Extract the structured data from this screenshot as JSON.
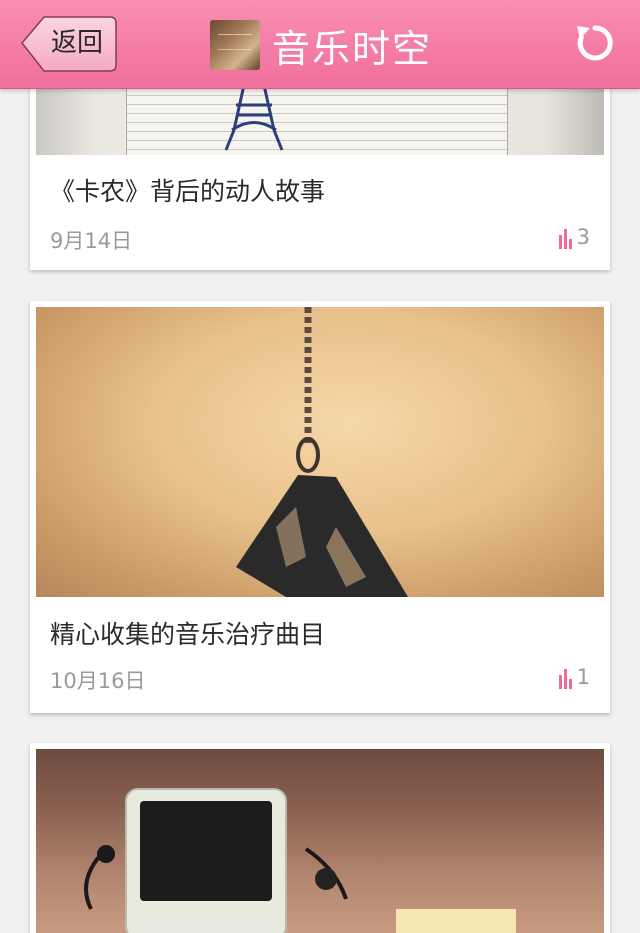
{
  "header": {
    "back_label": "返回",
    "title": "音乐时空",
    "refresh_icon": "refresh-icon",
    "colors": {
      "bar": "#f27aa4",
      "title": "#ffffff"
    }
  },
  "articles": [
    {
      "title": "《卡农》背后的动人故事",
      "date": "9月14日",
      "views": "3"
    },
    {
      "title": "精心收集的音乐治疗曲目",
      "date": "10月16日",
      "views": "1"
    },
    {
      "title": "",
      "date": "",
      "views": ""
    }
  ],
  "icons": {
    "views": "bar-chart-icon",
    "back": "back-arrow-icon"
  },
  "colors": {
    "accent": "#ee6a97",
    "card": "#ffffff",
    "page": "#f2f0f1"
  }
}
